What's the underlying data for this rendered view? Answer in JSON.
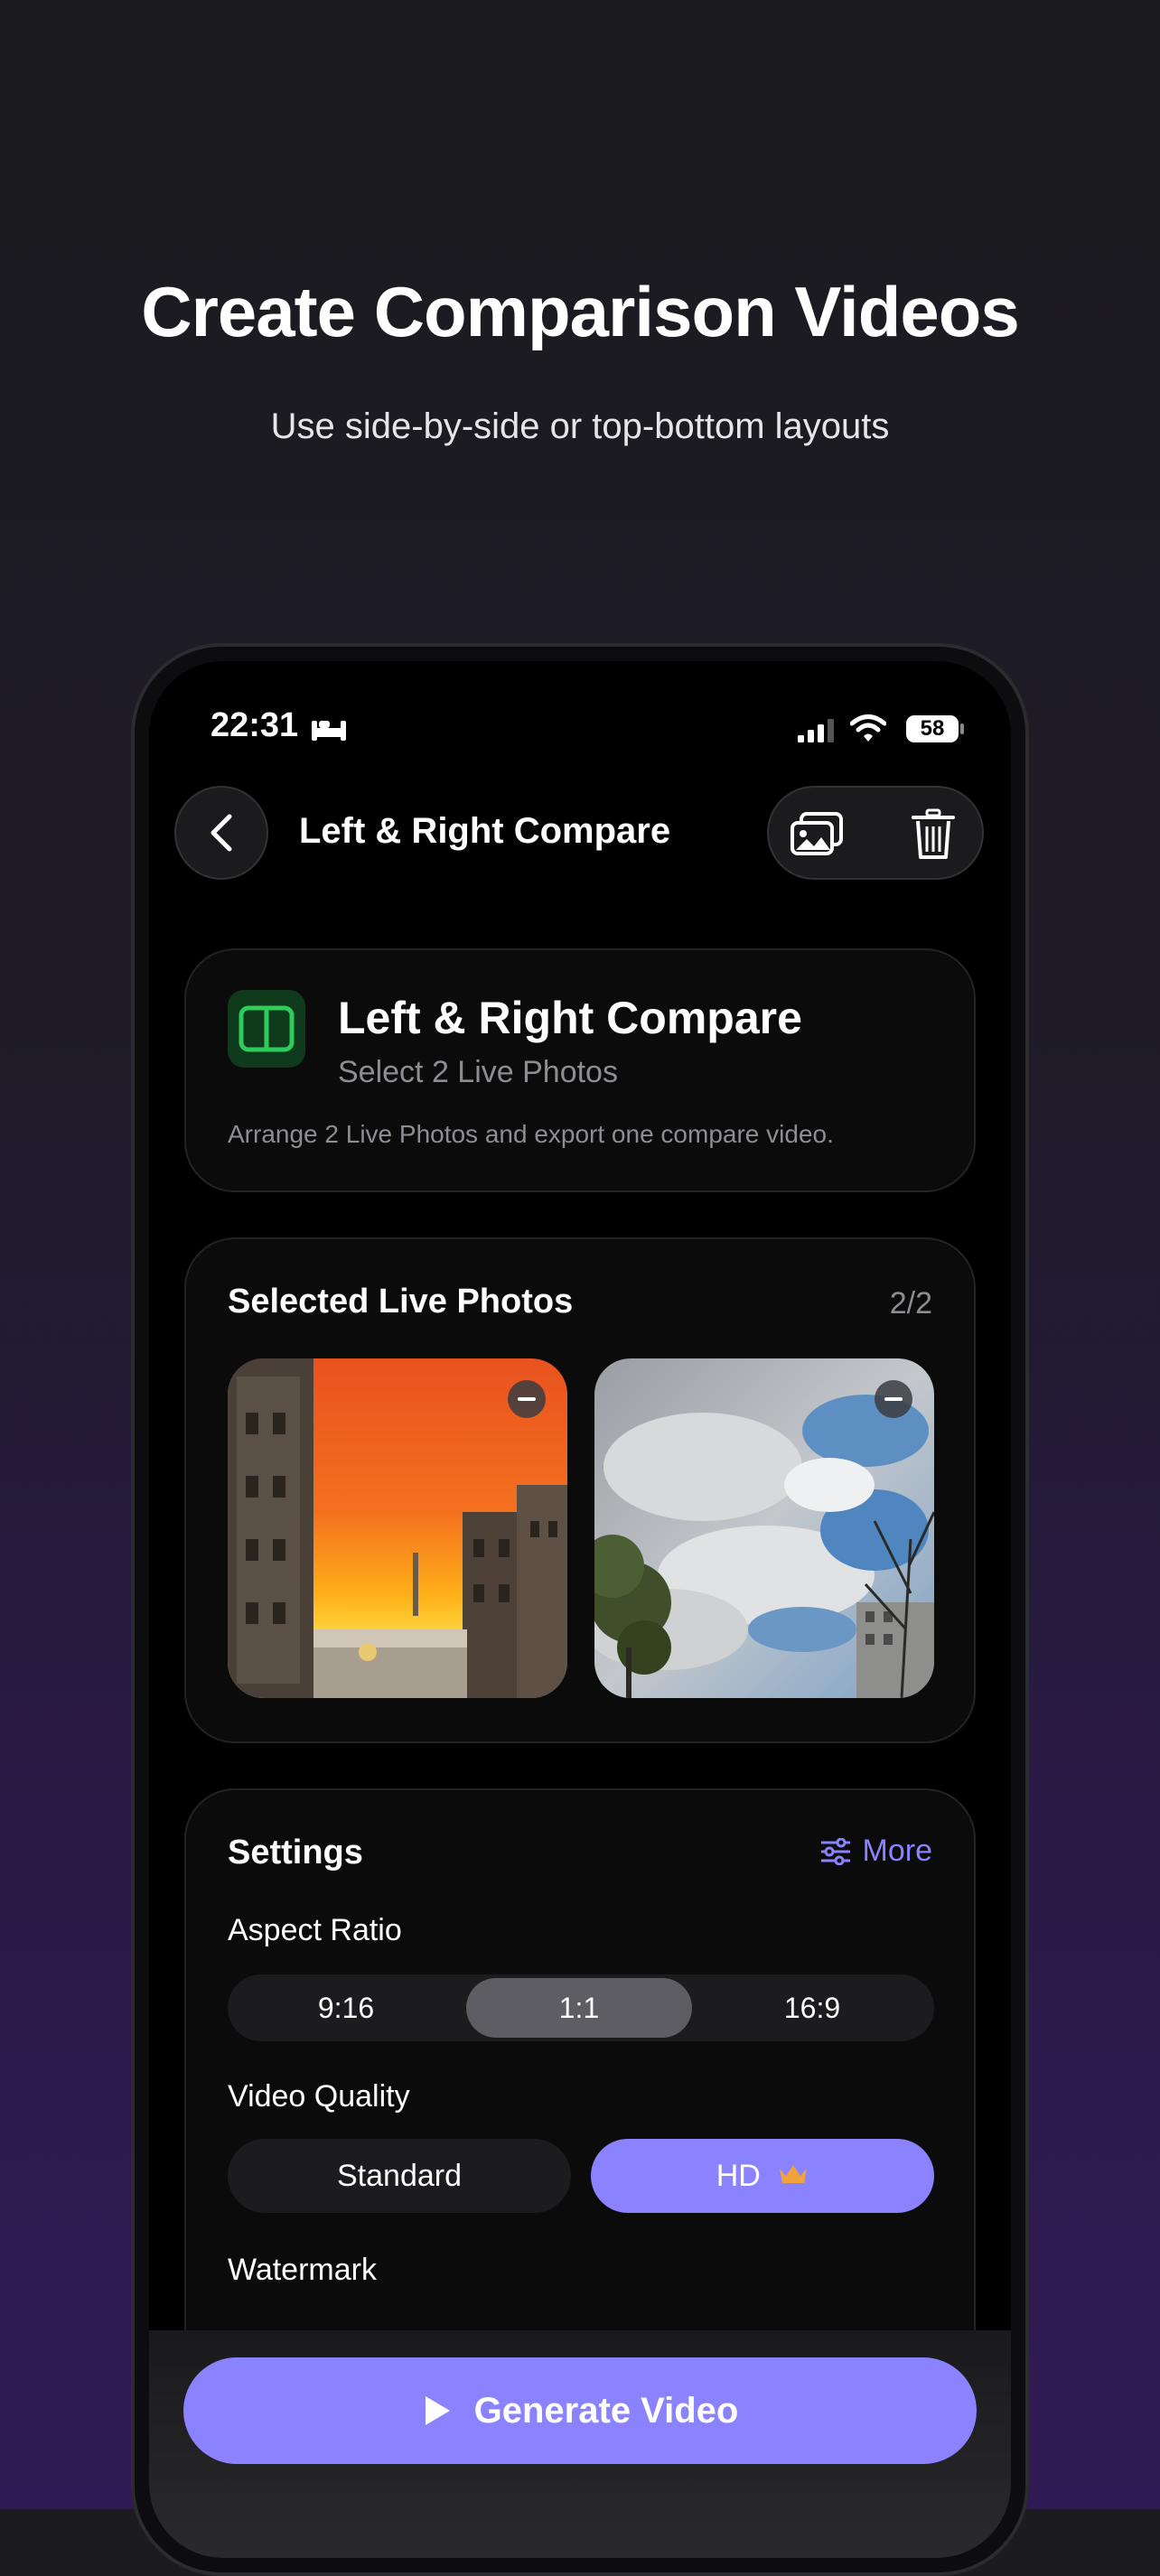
{
  "marketing": {
    "headline": "Create Comparison Videos",
    "subline": "Use side-by-side or top-bottom layouts"
  },
  "status_bar": {
    "time": "22:31",
    "battery": "58"
  },
  "nav": {
    "title": "Left & Right Compare"
  },
  "mode_card": {
    "title": "Left & Right Compare",
    "subtitle": "Select 2 Live Photos",
    "description": "Arrange 2 Live Photos and export one compare video.",
    "icon": "split-columns-icon",
    "accent": "#2ecc5a"
  },
  "selected_photos": {
    "title": "Selected Live Photos",
    "count": "2/2"
  },
  "settings": {
    "title": "Settings",
    "more_label": "More",
    "aspect_ratio": {
      "label": "Aspect Ratio",
      "options": [
        "9:16",
        "1:1",
        "16:9"
      ],
      "selected": "1:1"
    },
    "video_quality": {
      "label": "Video Quality",
      "options": [
        "Standard",
        "HD"
      ],
      "selected": "HD"
    },
    "watermark": {
      "label": "Watermark"
    }
  },
  "generate_button": {
    "label": "Generate Video"
  },
  "colors": {
    "accent": "#8a82ff",
    "crown": "#f0a23c"
  }
}
